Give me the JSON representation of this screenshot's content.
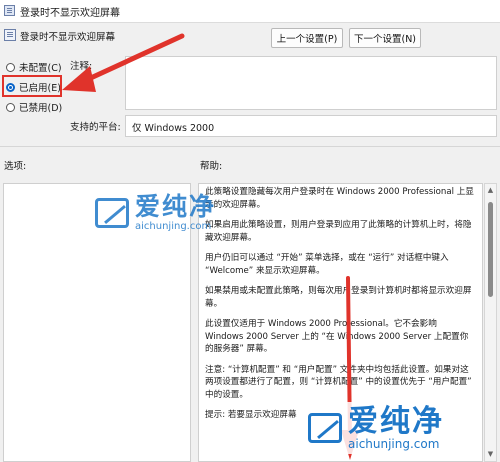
{
  "window": {
    "title": "登录时不显示欢迎屏幕",
    "icon": "policy-window-icon"
  },
  "header": {
    "policy_name": "登录时不显示欢迎屏幕",
    "prev_button": "上一个设置(P)",
    "next_button": "下一个设置(N)"
  },
  "state_options": [
    {
      "label": "未配置(C)",
      "selected": false
    },
    {
      "label": "已启用(E)",
      "selected": true
    },
    {
      "label": "已禁用(D)",
      "selected": false
    }
  ],
  "comment": {
    "label": "注释:",
    "value": ""
  },
  "platform": {
    "label": "支持的平台:",
    "value": "仅 Windows 2000"
  },
  "options_label": "选项:",
  "help_label": "帮助:",
  "help_paragraphs": [
    "此策略设置隐藏每次用户登录时在 Windows 2000 Professional 上显示的欢迎屏幕。",
    "如果启用此策略设置，则用户登录到应用了此策略的计算机上时，将隐藏欢迎屏幕。",
    "用户仍旧可以通过 “开始” 菜单选择，或在 “运行” 对话框中键入 “Welcome” 来显示欢迎屏幕。",
    "如果禁用或未配置此策略，则每次用户登录到计算机时都将显示欢迎屏幕。",
    "此设置仅适用于 Windows 2000 Professional。它不会影响 Windows 2000 Server 上的 “在 Windows 2000 Server 上配置你的服务器” 屏幕。",
    "注意: “计算机配置” 和 “用户配置” 文件夹中均包括此设置。如果对这两项设置都进行了配置，则 “计算机配置” 中的设置优先于 “用户配置” 中的设置。",
    "提示: 若要显示欢迎屏幕"
  ],
  "watermark": {
    "brand": "爱纯净",
    "domain": "aichunjing.com"
  },
  "colors": {
    "accent": "#0a64c8",
    "highlight": "#e0332b",
    "arrow": "#e0332b",
    "watermark": "#1f78c8"
  }
}
